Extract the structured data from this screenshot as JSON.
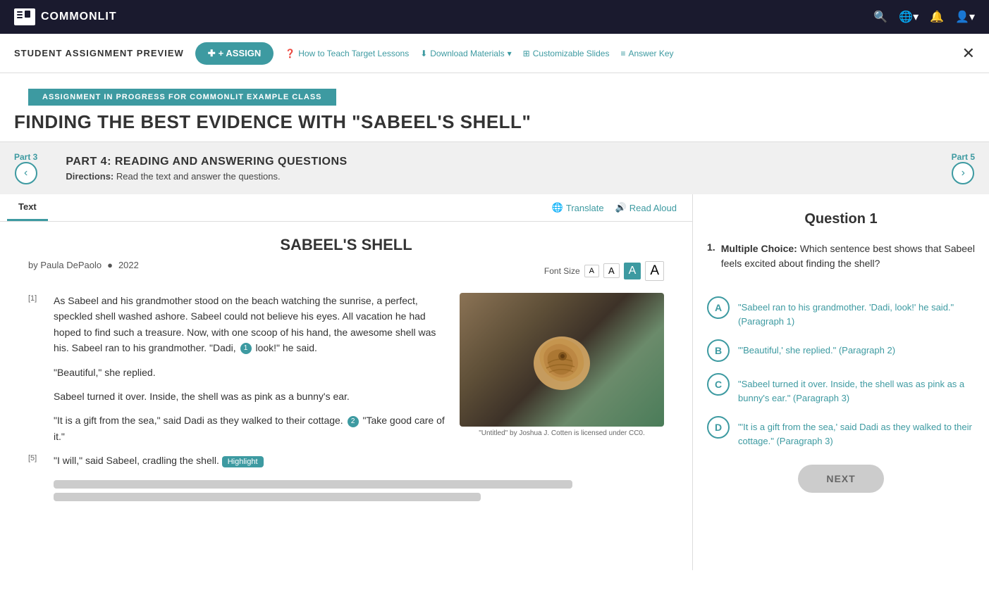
{
  "topNav": {
    "logo": "COMMONLIT",
    "searchIcon": "🔍",
    "globeIcon": "🌐",
    "bellIcon": "🔔",
    "userIcon": "👤"
  },
  "headerBar": {
    "previewTitle": "STUDENT ASSIGNMENT PREVIEW",
    "assignBtn": "+ ASSIGN",
    "links": [
      {
        "icon": "?",
        "label": "How to Teach Target Lessons"
      },
      {
        "icon": "↓",
        "label": "Download Materials"
      },
      {
        "icon": "□",
        "label": "Customizable Slides"
      },
      {
        "icon": "≡",
        "label": "Answer Key"
      }
    ],
    "closeBtn": "✕"
  },
  "assignmentBanner": "ASSIGNMENT IN PROGRESS FOR COMMONLIT EXAMPLE CLASS",
  "pageTitle": "FINDING THE BEST EVIDENCE WITH \"SABEEL'S SHELL\"",
  "partNav": {
    "leftLabel": "Part 3",
    "leftArrow": "‹",
    "rightLabel": "Part 5",
    "rightArrow": "›",
    "partTitle": "PART 4: READING AND ANSWERING QUESTIONS",
    "directionsLabel": "Directions:",
    "directionsText": "Read the text and answer the questions."
  },
  "textPanel": {
    "tab": "Text",
    "translateBtn": "Translate",
    "readAloudBtn": "Read Aloud",
    "storyTitle": "SABEEL'S SHELL",
    "byline": "by Paula DePaolo",
    "year": "2022",
    "fontSizeLabel": "Font Size",
    "fontSizes": [
      "A",
      "A",
      "A",
      "A"
    ],
    "activeFontIndex": 2,
    "paragraphs": [
      {
        "num": "[1]",
        "text": "As Sabeel and his grandmother stood on the beach watching the sunrise, a perfect, speckled shell washed ashore. Sabeel could not believe his eyes. All vacation he had hoped to find such a treasure. Now, with one scoop of his hand, the awesome shell was his. Sabeel ran to his grandmother. \"Dadi, look!\" he said.",
        "inlineNum": "1"
      },
      {
        "num": "",
        "text": "\"Beautiful,\" she replied.",
        "inlineNum": null
      },
      {
        "num": "",
        "text": "Sabeel turned it over. Inside, the shell was as pink as a bunny's ear.",
        "inlineNum": null
      },
      {
        "num": "",
        "text": "\"It is a gift from the sea,\" said Dadi as they walked to their cottage.",
        "inlineNum": "2",
        "afterText": " \"Take good care of it.\""
      },
      {
        "num": "[5]",
        "text": "\"I will,\" said Sabeel, cradling the shell.",
        "hasHighlight": true
      }
    ],
    "blurredLines": 2,
    "imagePlaceholderAlt": "Shell on beach",
    "imageCaption": "\"Untitled\" by Joshua J. Cotten is licensed under CC0."
  },
  "questionPanel": {
    "title": "Question 1",
    "questionNum": "1.",
    "questionType": "Multiple Choice:",
    "questionText": "Which sentence best shows that Sabeel feels excited about finding the shell?",
    "options": [
      {
        "letter": "A",
        "text": "\"Sabeel ran to his grandmother. 'Dadi, look!' he said.\" (Paragraph 1)"
      },
      {
        "letter": "B",
        "text": "\"'Beautiful,' she replied.\" (Paragraph 2)"
      },
      {
        "letter": "C",
        "text": "\"Sabeel turned it over. Inside, the shell was as pink as a bunny's ear.\" (Paragraph 3)"
      },
      {
        "letter": "D",
        "text": "\"'It is a gift from the sea,' said Dadi as they walked to their cottage.\" (Paragraph 3)"
      }
    ],
    "nextBtn": "NEXT"
  }
}
